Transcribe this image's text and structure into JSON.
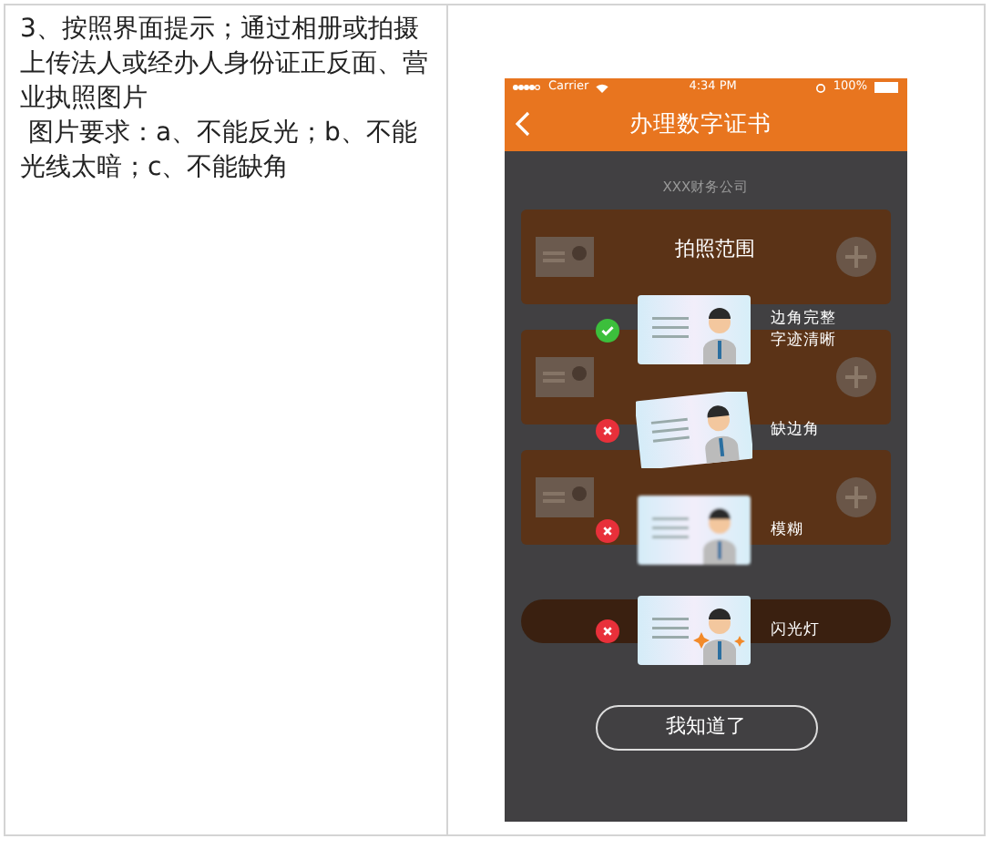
{
  "instructions": {
    "steps": "3、按照界面提示；通过相册或拍摄上传法人或经办人身份证正反面、营业执照图片",
    "requirements": " 图片要求：a、不能反光；b、不能光线太暗；c、不能缺角"
  },
  "phone": {
    "status_bar": {
      "carrier": "Carrier",
      "time": "4:34 PM",
      "battery": "100%"
    },
    "nav": {
      "title": "办理数字证书"
    },
    "company": "XXX财务公司",
    "upload_rows": [
      {
        "kind": "card"
      },
      {
        "kind": "card"
      },
      {
        "kind": "card"
      },
      {
        "kind": "pill"
      }
    ],
    "overlay": {
      "title": "拍照范围",
      "samples": [
        {
          "kind": "ok",
          "valid": true,
          "label": "边角完整",
          "label_2": "字迹清晰"
        },
        {
          "kind": "skewed",
          "valid": false,
          "label": "缺边角"
        },
        {
          "kind": "blurry",
          "valid": false,
          "label": "模糊"
        },
        {
          "kind": "flash",
          "valid": false,
          "label": "闪光灯"
        }
      ],
      "button": "我知道了"
    }
  }
}
